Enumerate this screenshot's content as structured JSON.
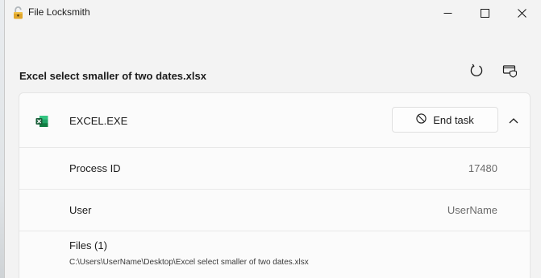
{
  "window": {
    "title": "File Locksmith",
    "app_icon": "padlock-icon"
  },
  "caption_buttons": {
    "minimize_icon": "minimize-icon",
    "maximize_icon": "maximize-icon",
    "close_icon": "close-icon"
  },
  "header": {
    "file_name": "Excel select smaller of two dates.xlsx",
    "refresh_icon": "refresh-icon",
    "admin_icon": "restart-as-admin-icon"
  },
  "process": {
    "icon": "excel-icon",
    "name": "EXCEL.EXE",
    "end_task_label": "End task",
    "end_task_icon": "block-icon",
    "expanded": true,
    "details": {
      "pid_label": "Process ID",
      "pid_value": "17480",
      "user_label": "User",
      "user_value": "UserName",
      "files_label": "Files (1)",
      "files": [
        "C:\\Users\\UserName\\Desktop\\Excel select smaller of two dates.xlsx"
      ]
    }
  },
  "colors": {
    "window_bg": "#f3f3f3",
    "card_bg": "#fbfbfb",
    "excel_green": "#1d6f42",
    "secondary_text": "#6b6b6b"
  }
}
